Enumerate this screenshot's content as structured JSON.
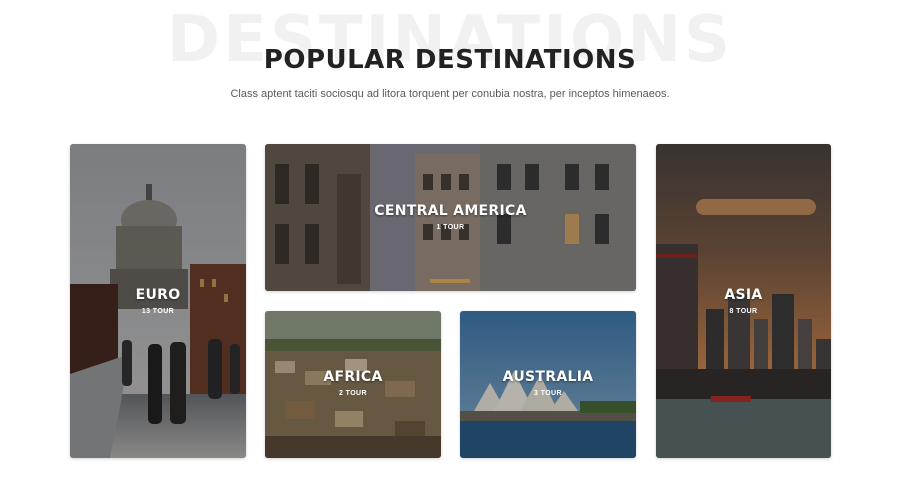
{
  "header": {
    "background_word": "DESTINATIONS",
    "title": "POPULAR DESTINATIONS",
    "subtitle": "Class aptent taciti sociosqu ad litora torquent per conubia nostra, per inceptos himenaeos."
  },
  "destinations": [
    {
      "name": "EURO",
      "count": "13 TOUR"
    },
    {
      "name": "CENTRAL AMERICA",
      "count": "1 TOUR"
    },
    {
      "name": "AFRICA",
      "count": "2 TOUR"
    },
    {
      "name": "AUSTRALIA",
      "count": "3 TOUR"
    },
    {
      "name": "ASIA",
      "count": "8 TOUR"
    }
  ]
}
